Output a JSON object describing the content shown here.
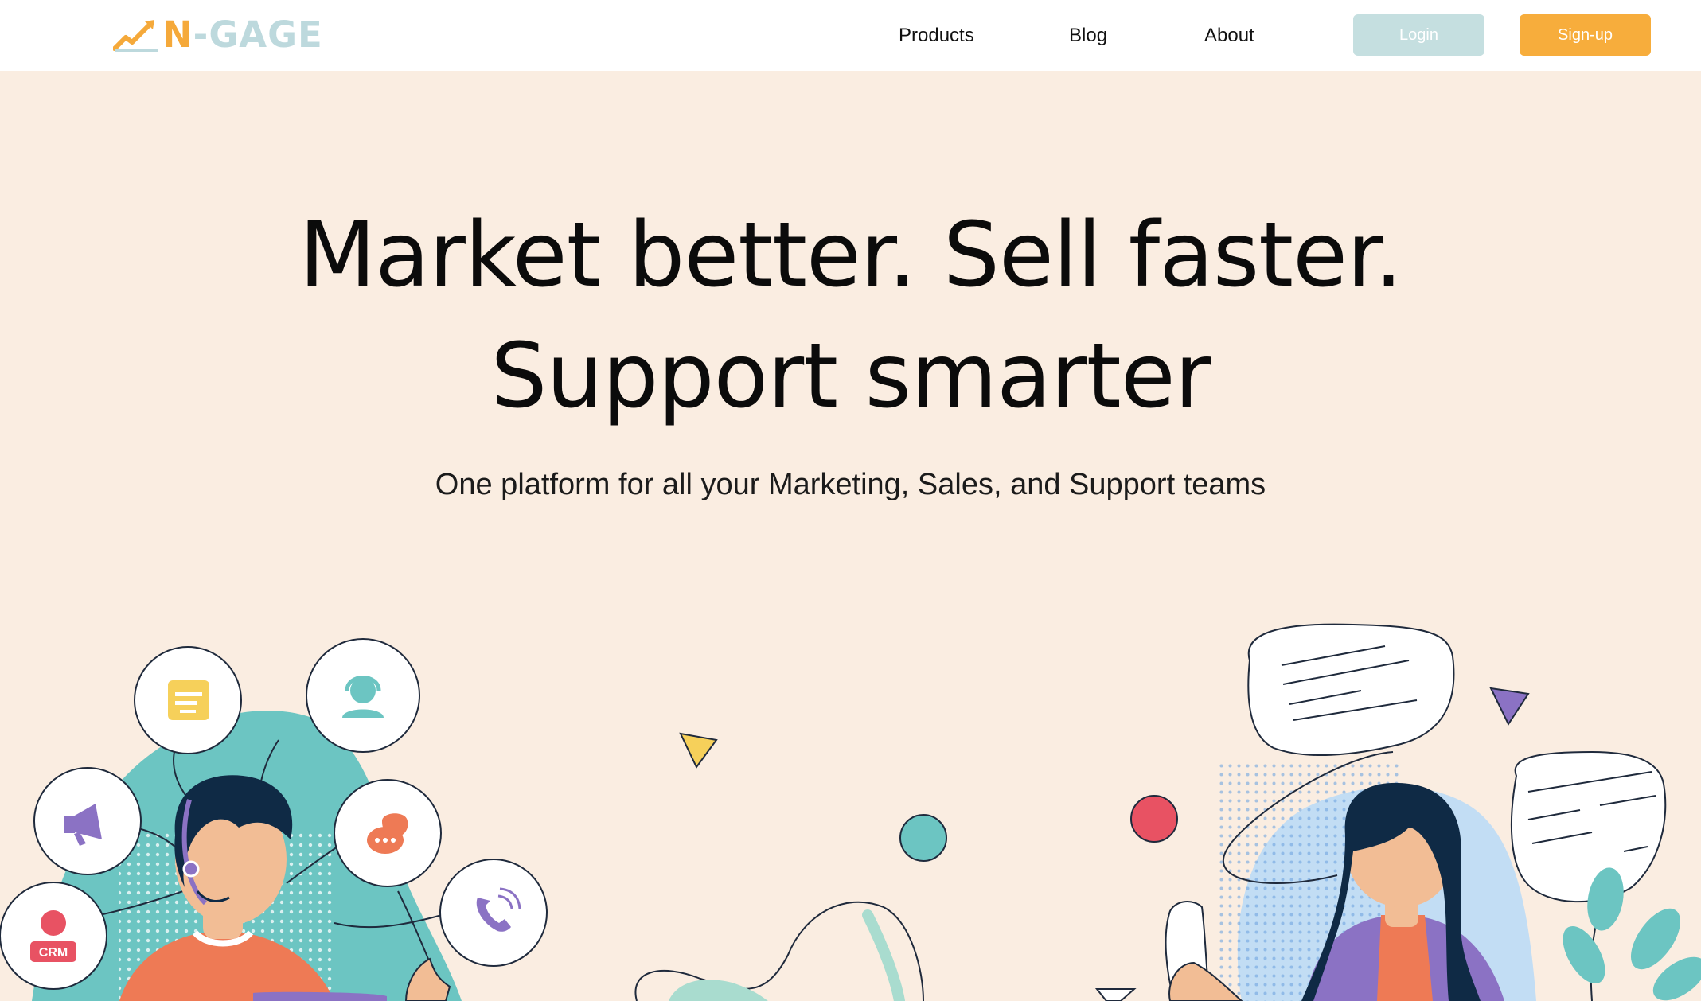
{
  "brand": {
    "name_prefix": "N",
    "name_suffix": "-GAGE"
  },
  "nav": {
    "products": "Products",
    "blog": "Blog",
    "about": "About"
  },
  "auth": {
    "login": "Login",
    "signup": "Sign-up"
  },
  "hero": {
    "line1": "Market better. Sell faster.",
    "line2": "Support smarter",
    "subtitle": "One platform for all your Marketing, Sales, and Support teams"
  },
  "illustration": {
    "crm_badge": "CRM"
  },
  "colors": {
    "background": "#faede1",
    "accent_orange": "#f7ad3c",
    "login_button": "#c5dfe0",
    "teal": "#6cc5c2",
    "purple": "#8b72c4",
    "coral": "#ee7a55",
    "red": "#e85263",
    "yellow": "#f6d05a"
  }
}
